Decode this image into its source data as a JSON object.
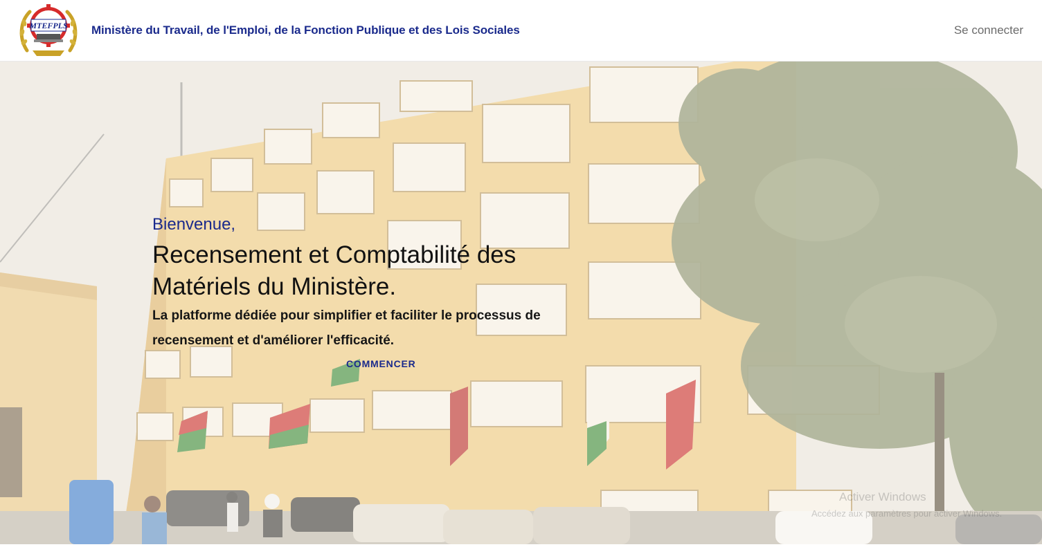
{
  "header": {
    "logo_text": "MTEFPLS",
    "title": "Ministère du Travail, de l'Emploi, de la Fonction Publique et des Lois Sociales",
    "login_label": "Se connecter"
  },
  "hero": {
    "welcome": "Bienvenue,",
    "headline": "Recensement et Comptabilité des Matériels du Ministère.",
    "subtitle": "La platforme dédiée pour simplifier et faciliter le processus de recensement et d'améliorer l'efficacité.",
    "cta_label": "COMMENCER"
  },
  "watermark": {
    "title": "Activer Windows",
    "subtitle": "Accédez aux paramètres pour activer Windows."
  },
  "colors": {
    "brand_blue": "#1a2a8c",
    "building": "#e8c98a"
  }
}
